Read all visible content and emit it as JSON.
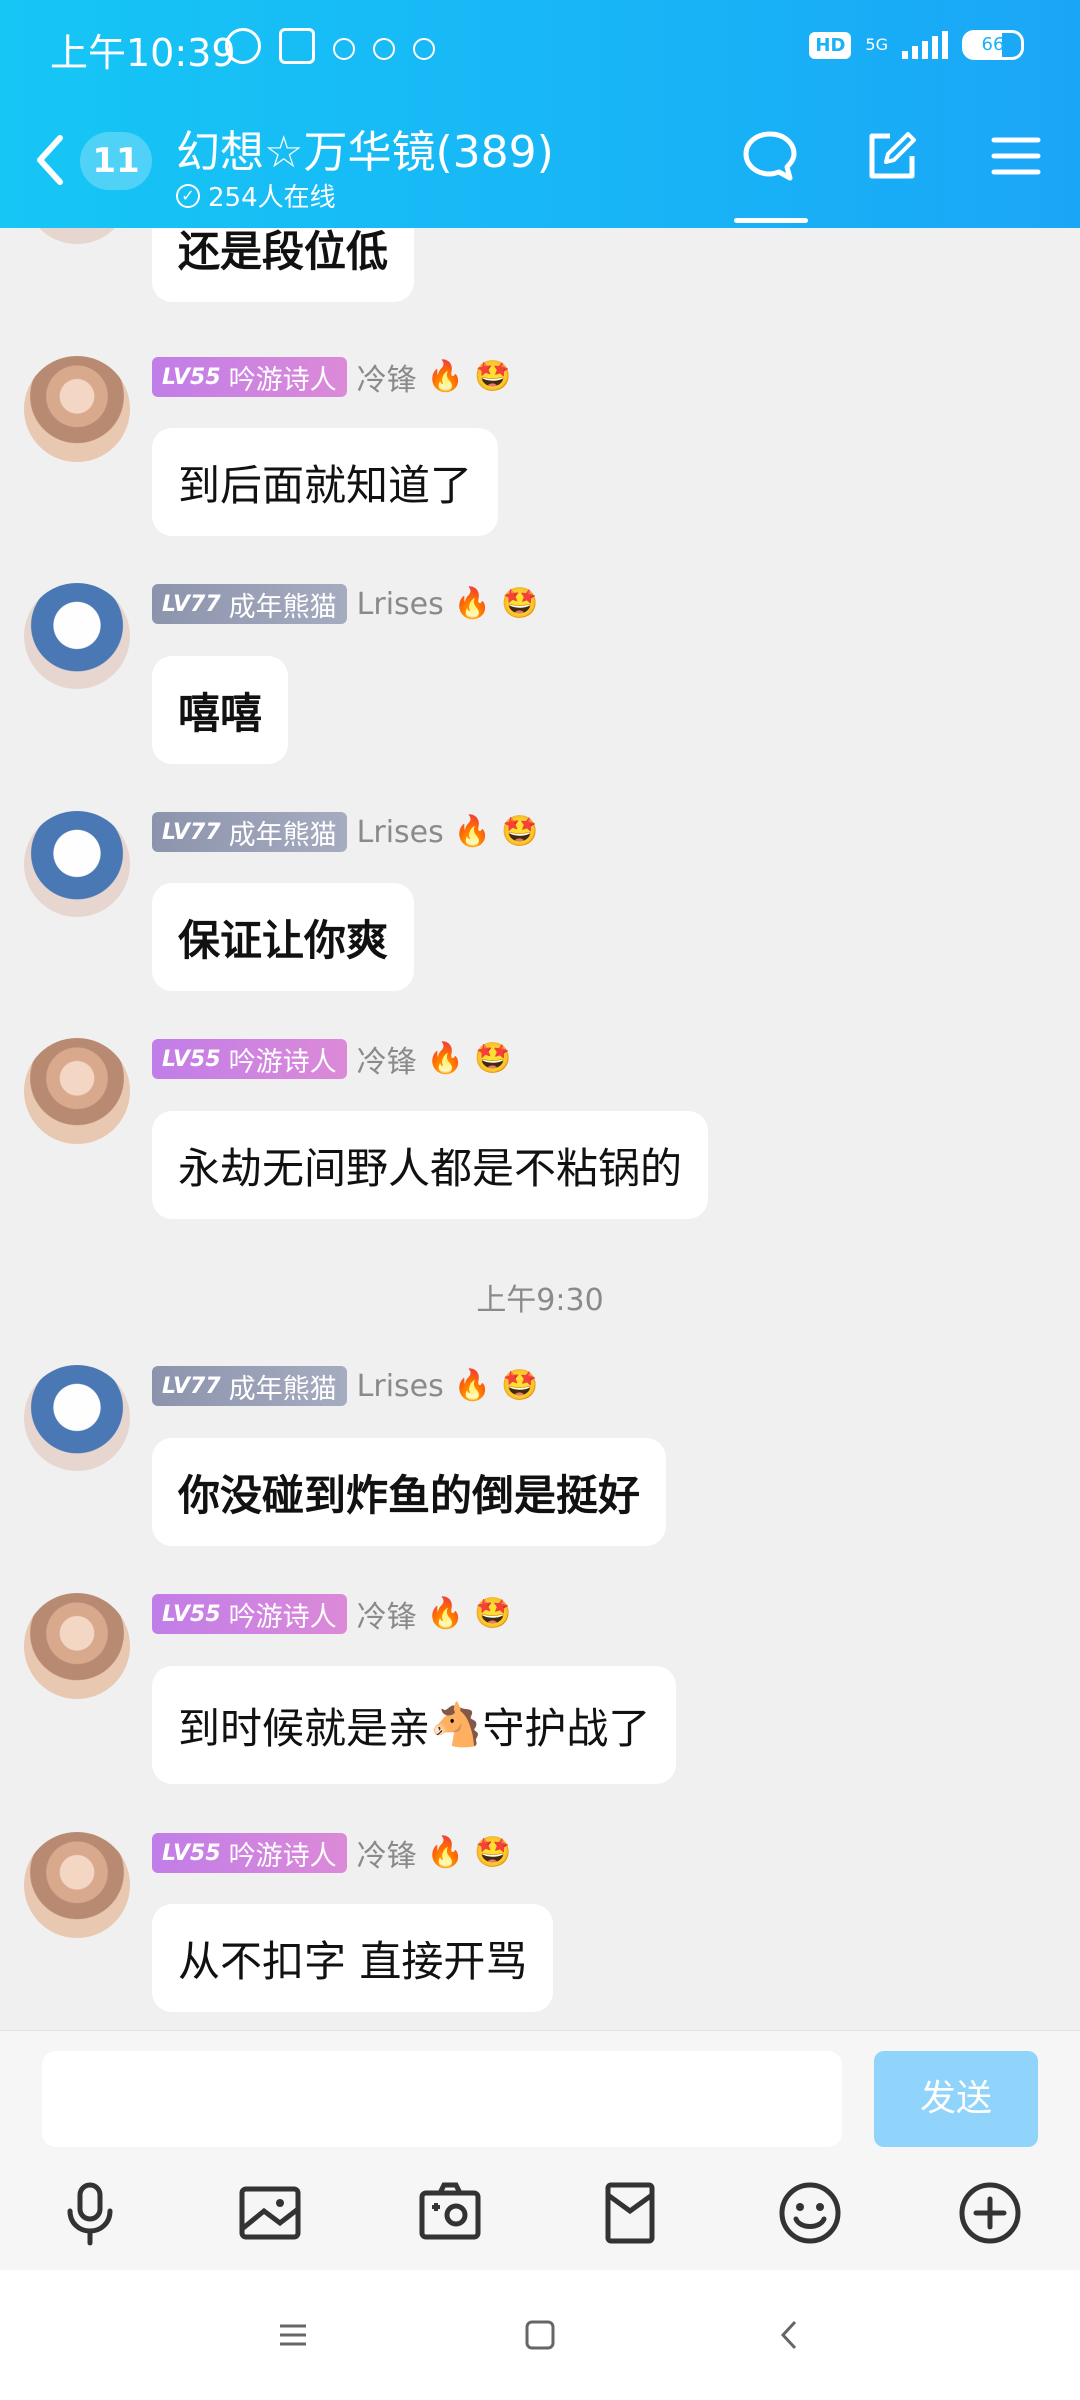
{
  "status_bar": {
    "time": "上午10:39",
    "hd": "HD",
    "network": "5G",
    "battery": "66",
    "battery_level": 0.66
  },
  "header": {
    "unread_count": "11",
    "title": "幻想☆万华镜(389)",
    "online": "254人在线",
    "icons": [
      "chat-icon",
      "edit-icon",
      "menu-icon"
    ]
  },
  "messages": [
    {
      "text": "还是段位低",
      "handwriting": true
    },
    {
      "level": "LV55",
      "title": "吟游诗人",
      "nick": "冷锋",
      "avatar": "girl",
      "text": "到后面就知道了"
    },
    {
      "level": "LV77",
      "title": "成年熊猫",
      "nick": "Lrises",
      "avatar": "panda",
      "text": "嘻嘻",
      "handwriting": true
    },
    {
      "level": "LV77",
      "title": "成年熊猫",
      "nick": "Lrises",
      "avatar": "panda",
      "text": "保证让你爽",
      "handwriting": true
    },
    {
      "level": "LV55",
      "title": "吟游诗人",
      "nick": "冷锋",
      "avatar": "girl",
      "text": "永劫无间野人都是不粘锅的"
    },
    {
      "timestamp": "上午9:30"
    },
    {
      "level": "LV77",
      "title": "成年熊猫",
      "nick": "Lrises",
      "avatar": "panda",
      "text": "你没碰到炸鱼的倒是挺好",
      "handwriting": true
    },
    {
      "level": "LV55",
      "title": "吟游诗人",
      "nick": "冷锋",
      "avatar": "girl",
      "text_before": "到时候就是亲",
      "emoji": "🐴",
      "text_after": "守护战了"
    },
    {
      "level": "LV55",
      "title": "吟游诗人",
      "nick": "冷锋",
      "avatar": "girl",
      "text": "从不扣字 直接开骂"
    }
  ],
  "badges": {
    "fire": "🔥",
    "flower": "🤩"
  },
  "input": {
    "placeholder": "",
    "send_label": "发送"
  },
  "toolbar": [
    "microphone-icon",
    "image-icon",
    "camera-icon",
    "red-packet-icon",
    "emoji-icon",
    "plus-icon"
  ],
  "colors": {
    "header": "#18b4f6",
    "poet_badge": "#c17de8",
    "panda_badge": "#8c94ad",
    "send_button": "#90d3fb",
    "chat_bg": "#f0f0f0"
  }
}
